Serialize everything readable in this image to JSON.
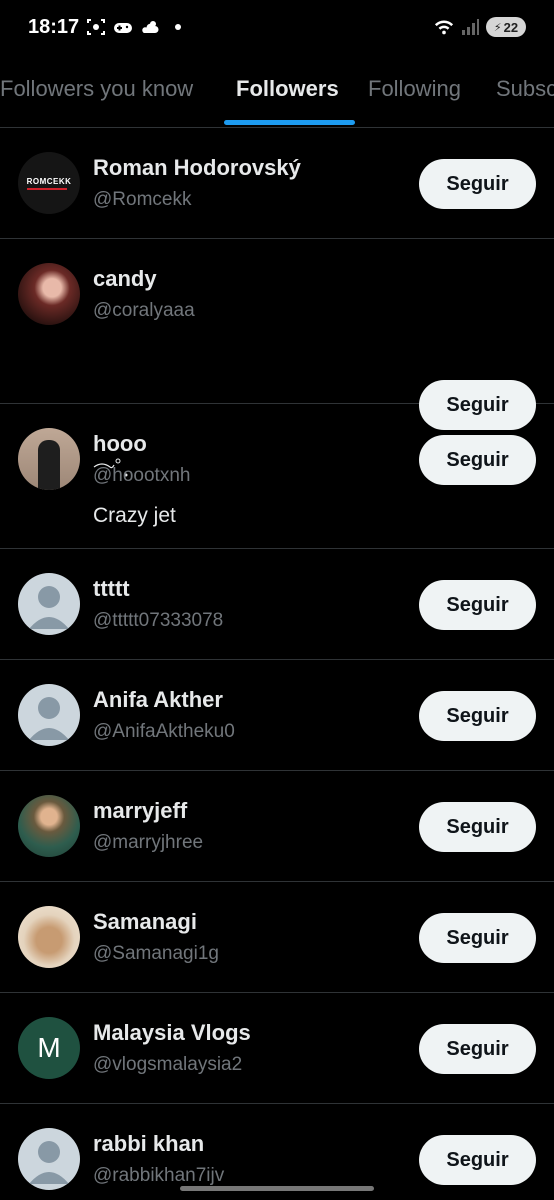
{
  "status_bar": {
    "time": "18:17",
    "battery": "22"
  },
  "tabs": [
    {
      "label": "Followers you know",
      "active": false
    },
    {
      "label": "Followers",
      "active": true
    },
    {
      "label": "Following",
      "active": false
    },
    {
      "label": "Subsc",
      "active": false
    }
  ],
  "follow_label": "Seguir",
  "users": [
    {
      "name": "Roman Hodorovský",
      "handle": "@Romcekk",
      "bio": "",
      "avatar": "romcekk-logo",
      "avatar_text": "ROMCEKK"
    },
    {
      "name": "candy",
      "handle": "@coralyaaa",
      "bio": "",
      "avatar": "photo"
    },
    {
      "name": "hooo",
      "handle": "@hoootxnh",
      "bio": "Crazy jet",
      "avatar": "photo"
    },
    {
      "name": "ttttt",
      "handle": "@ttttt07333078",
      "bio": "",
      "avatar": "default"
    },
    {
      "name": "Anifa Akther",
      "handle": "@AnifaAktheku0",
      "bio": "",
      "avatar": "default"
    },
    {
      "name": "marryjeff",
      "handle": "@marryjhree",
      "bio": "",
      "avatar": "photo"
    },
    {
      "name": "Samanagi",
      "handle": "@Samanagi1g",
      "bio": "",
      "avatar": "photo"
    },
    {
      "name": "Malaysia Vlogs",
      "handle": "@vlogsmalaysia2",
      "bio": "",
      "avatar": "letter",
      "avatar_letter": "M"
    },
    {
      "name": "rabbi khan",
      "handle": "@rabbikhan7ijv",
      "bio": "",
      "avatar": "default"
    }
  ],
  "colors": {
    "background": "#000000",
    "accent": "#1d9bf0",
    "muted_text": "#71767b",
    "divider": "#2f3336",
    "button_bg": "#eff3f4"
  }
}
